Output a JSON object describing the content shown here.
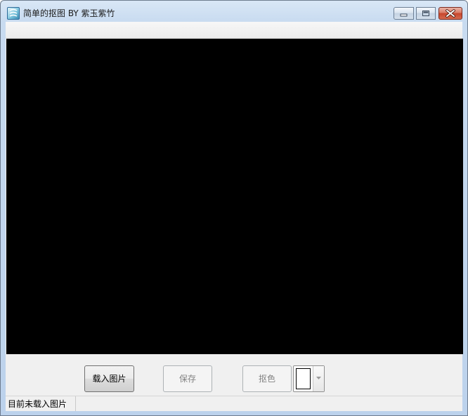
{
  "window": {
    "title": "简单的抠图 BY 紫玉紫竹",
    "icon": "app-icon"
  },
  "buttons": {
    "load_label": "载入图片",
    "save_label": "保存",
    "cut_label": "抠色"
  },
  "color_picker": {
    "selected_color": "#ffffff"
  },
  "status": {
    "text": "目前未载入图片"
  },
  "colors": {
    "canvas": "#000000",
    "client_bg": "#f0f0f0",
    "close_button": "#c7452c"
  }
}
